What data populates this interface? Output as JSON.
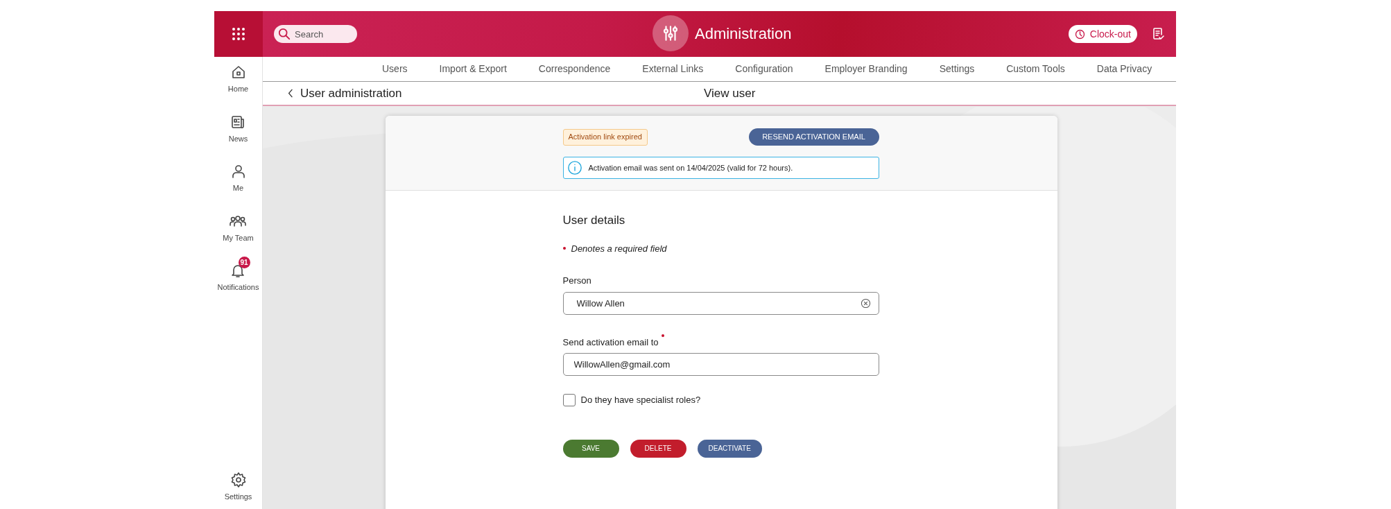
{
  "header": {
    "search_placeholder": "Search",
    "title": "Administration",
    "clock_button": "Clock-out"
  },
  "sidebar": {
    "items": [
      {
        "label": "Home"
      },
      {
        "label": "News"
      },
      {
        "label": "Me"
      },
      {
        "label": "My Team"
      },
      {
        "label": "Notifications",
        "badge": "91"
      }
    ],
    "footer": {
      "label": "Settings"
    }
  },
  "nav_tabs": [
    {
      "label": "Users",
      "selected": false
    },
    {
      "label": "Import & Export",
      "selected": false
    },
    {
      "label": "Correspondence",
      "selected": false
    },
    {
      "label": "External Links",
      "selected": false
    },
    {
      "label": "Configuration",
      "selected": false
    },
    {
      "label": "Employer Branding",
      "selected": false
    },
    {
      "label": "Settings",
      "selected": false
    },
    {
      "label": "Custom Tools",
      "selected": false
    },
    {
      "label": "Data Privacy",
      "selected": false
    }
  ],
  "breadcrumb": {
    "back_label": "User administration",
    "page_title": "View user"
  },
  "activation": {
    "status_badge": "Activation link expired",
    "resend_button": "RESEND ACTIVATION EMAIL",
    "info_message": "Activation email was sent on 14/04/2025 (valid for 72 hours)."
  },
  "form": {
    "title": "User details",
    "required_note": "Denotes a required field",
    "fields": [
      {
        "kind": "select",
        "label": "Person",
        "value": "Willow Allen",
        "required": false
      },
      {
        "kind": "text",
        "label": "Send activation email to",
        "value": "WillowAllen@gmail.com",
        "required": true
      }
    ],
    "checkbox": {
      "label": "Do they have specialist roles?",
      "checked": false
    },
    "buttons": [
      {
        "label": "SAVE",
        "kind": "save"
      },
      {
        "label": "DELETE",
        "kind": "delete"
      },
      {
        "label": "DEACTIVATE",
        "kind": "deactivate"
      }
    ]
  }
}
